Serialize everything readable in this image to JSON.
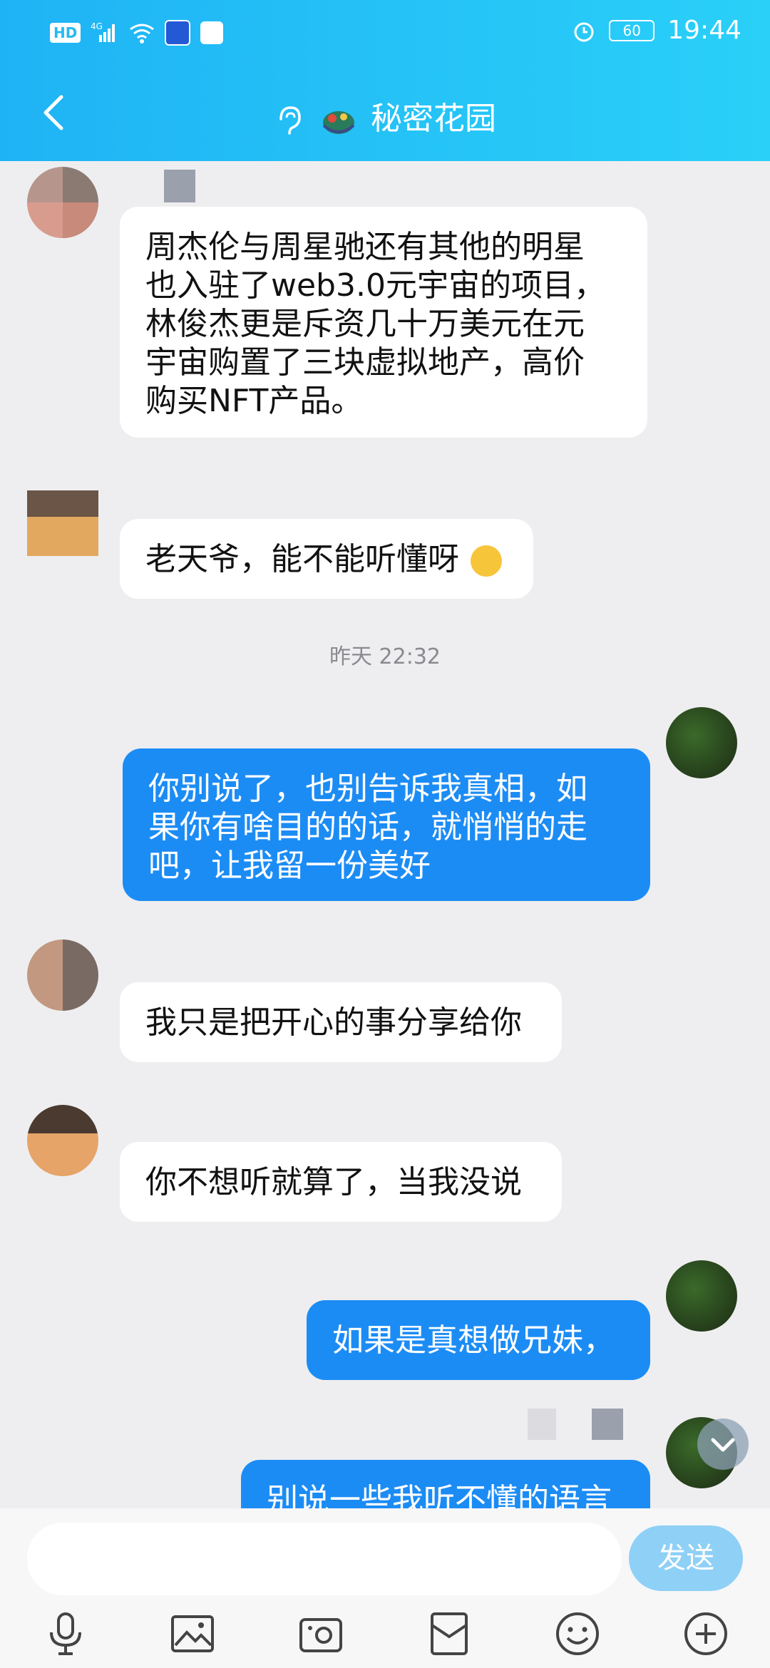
{
  "status_bar": {
    "left_label": "HD",
    "network": "4G",
    "battery": "60",
    "time": "19:44"
  },
  "header": {
    "title": "秘密花园",
    "icons": [
      "back-arrow-icon",
      "ear-icon",
      "dragon-emoji-icon"
    ]
  },
  "messages": [
    {
      "side": "left",
      "text_lines": [
        "周杰伦与周星驰还有其他的明星",
        "也入驻了web3.0元宇宙的项目，",
        "林俊杰更是斥资几十万美元在元",
        "宇宙购置了三块虚拟地产，高价",
        "购买NFT产品。"
      ]
    },
    {
      "side": "left",
      "text": "老天爷，能不能听懂呀"
    },
    {
      "side": "center",
      "text": "昨天 22:32"
    },
    {
      "side": "right",
      "text_lines": [
        "你别说了，也别告诉我真相，如",
        "果你有啥目的的话，就悄悄的走",
        "吧，让我留一份美好"
      ]
    },
    {
      "side": "left",
      "text": "我只是把开心的事分享给你"
    },
    {
      "side": "left",
      "text": "你不想听就算了，当我没说"
    },
    {
      "side": "right",
      "text": "如果是真想做兄妹，"
    },
    {
      "side": "right",
      "text": "别说一些我听不懂的语言"
    }
  ],
  "input_bar": {
    "placeholder": "",
    "send_label": "发送",
    "tools": [
      "microphone-icon",
      "image-icon",
      "camera-icon",
      "red-packet-icon",
      "emoji-icon",
      "plus-icon"
    ]
  },
  "colors": {
    "header_start": "#1fb3f5",
    "header_end": "#2ad0f8",
    "my_bubble": "#1c8cf5",
    "send_button": "#8fd0f6"
  }
}
